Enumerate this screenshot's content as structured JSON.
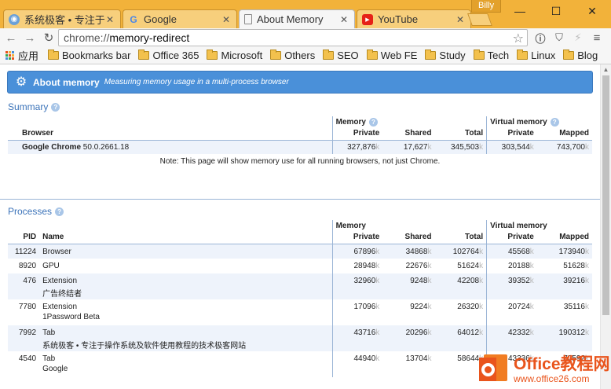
{
  "window": {
    "profile_name": "Billy",
    "tabs": [
      {
        "title": "系统极客 • 专注于操",
        "favicon": "globe-icon",
        "active": false
      },
      {
        "title": "Google",
        "favicon": "google-icon",
        "active": false
      },
      {
        "title": "About Memory",
        "favicon": "page-icon",
        "active": true
      },
      {
        "title": "YouTube",
        "favicon": "youtube-icon",
        "active": false
      }
    ]
  },
  "toolbar": {
    "url_scheme": "chrome://",
    "url_host": "memory-redirect"
  },
  "bookmarks": {
    "apps_label": "应用",
    "items": [
      "Bookmarks bar",
      "Office 365",
      "Microsoft",
      "Others",
      "SEO",
      "Web FE",
      "Study",
      "Tech",
      "Linux",
      "Blog"
    ]
  },
  "page": {
    "title": "About memory",
    "subtitle": "Measuring memory usage in a multi-process browser",
    "summary": {
      "title": "Summary",
      "group_memory": "Memory",
      "group_virtual": "Virtual memory",
      "col_browser": "Browser",
      "col_private": "Private",
      "col_shared": "Shared",
      "col_total": "Total",
      "col_vprivate": "Private",
      "col_mapped": "Mapped",
      "row": {
        "browser_name": "Google Chrome",
        "version": "50.0.2661.18",
        "private": "327,876",
        "shared": "17,627",
        "total": "345,503",
        "vprivate": "303,544",
        "mapped": "743,700"
      },
      "note": "Note: This page will show memory use for all running browsers, not just Chrome."
    },
    "processes": {
      "title": "Processes",
      "group_memory": "Memory",
      "group_virtual": "Virtual memory",
      "col_pid": "PID",
      "col_name": "Name",
      "col_private": "Private",
      "col_shared": "Shared",
      "col_total": "Total",
      "col_vprivate": "Private",
      "col_mapped": "Mapped",
      "unit": "k",
      "rows": [
        {
          "pid": "11224",
          "name": "Browser",
          "sub": "",
          "private": "67896",
          "shared": "34868",
          "total": "102764",
          "vprivate": "45568",
          "mapped": "173940"
        },
        {
          "pid": "8920",
          "name": "GPU",
          "sub": "",
          "private": "28948",
          "shared": "22676",
          "total": "51624",
          "vprivate": "20188",
          "mapped": "51628"
        },
        {
          "pid": "476",
          "name": "Extension",
          "sub": "广告终结者",
          "private": "32960",
          "shared": "9248",
          "total": "42208",
          "vprivate": "39352",
          "mapped": "39216"
        },
        {
          "pid": "7780",
          "name": "Extension",
          "sub": "1Password Beta",
          "private": "17096",
          "shared": "9224",
          "total": "26320",
          "vprivate": "20724",
          "mapped": "35116"
        },
        {
          "pid": "7992",
          "name": "Tab",
          "sub": "系统极客 • 专注于操作系统及软件使用教程的技术极客网站",
          "private": "43716",
          "shared": "20296",
          "total": "64012",
          "vprivate": "42332",
          "mapped": "190312"
        },
        {
          "pid": "4540",
          "name": "Tab",
          "sub": "Google",
          "private": "44940",
          "shared": "13704",
          "total": "58644",
          "vprivate": "43336",
          "mapped": "70592"
        }
      ]
    }
  },
  "watermark": {
    "line1": "Office教程网",
    "line2": "www.office26.com"
  },
  "colors": {
    "titlebar": "#f2b23a",
    "header_bar": "#4a90d9",
    "section_title": "#3b73b9",
    "row_highlight": "#eef3fb",
    "watermark": "#e9541c"
  }
}
